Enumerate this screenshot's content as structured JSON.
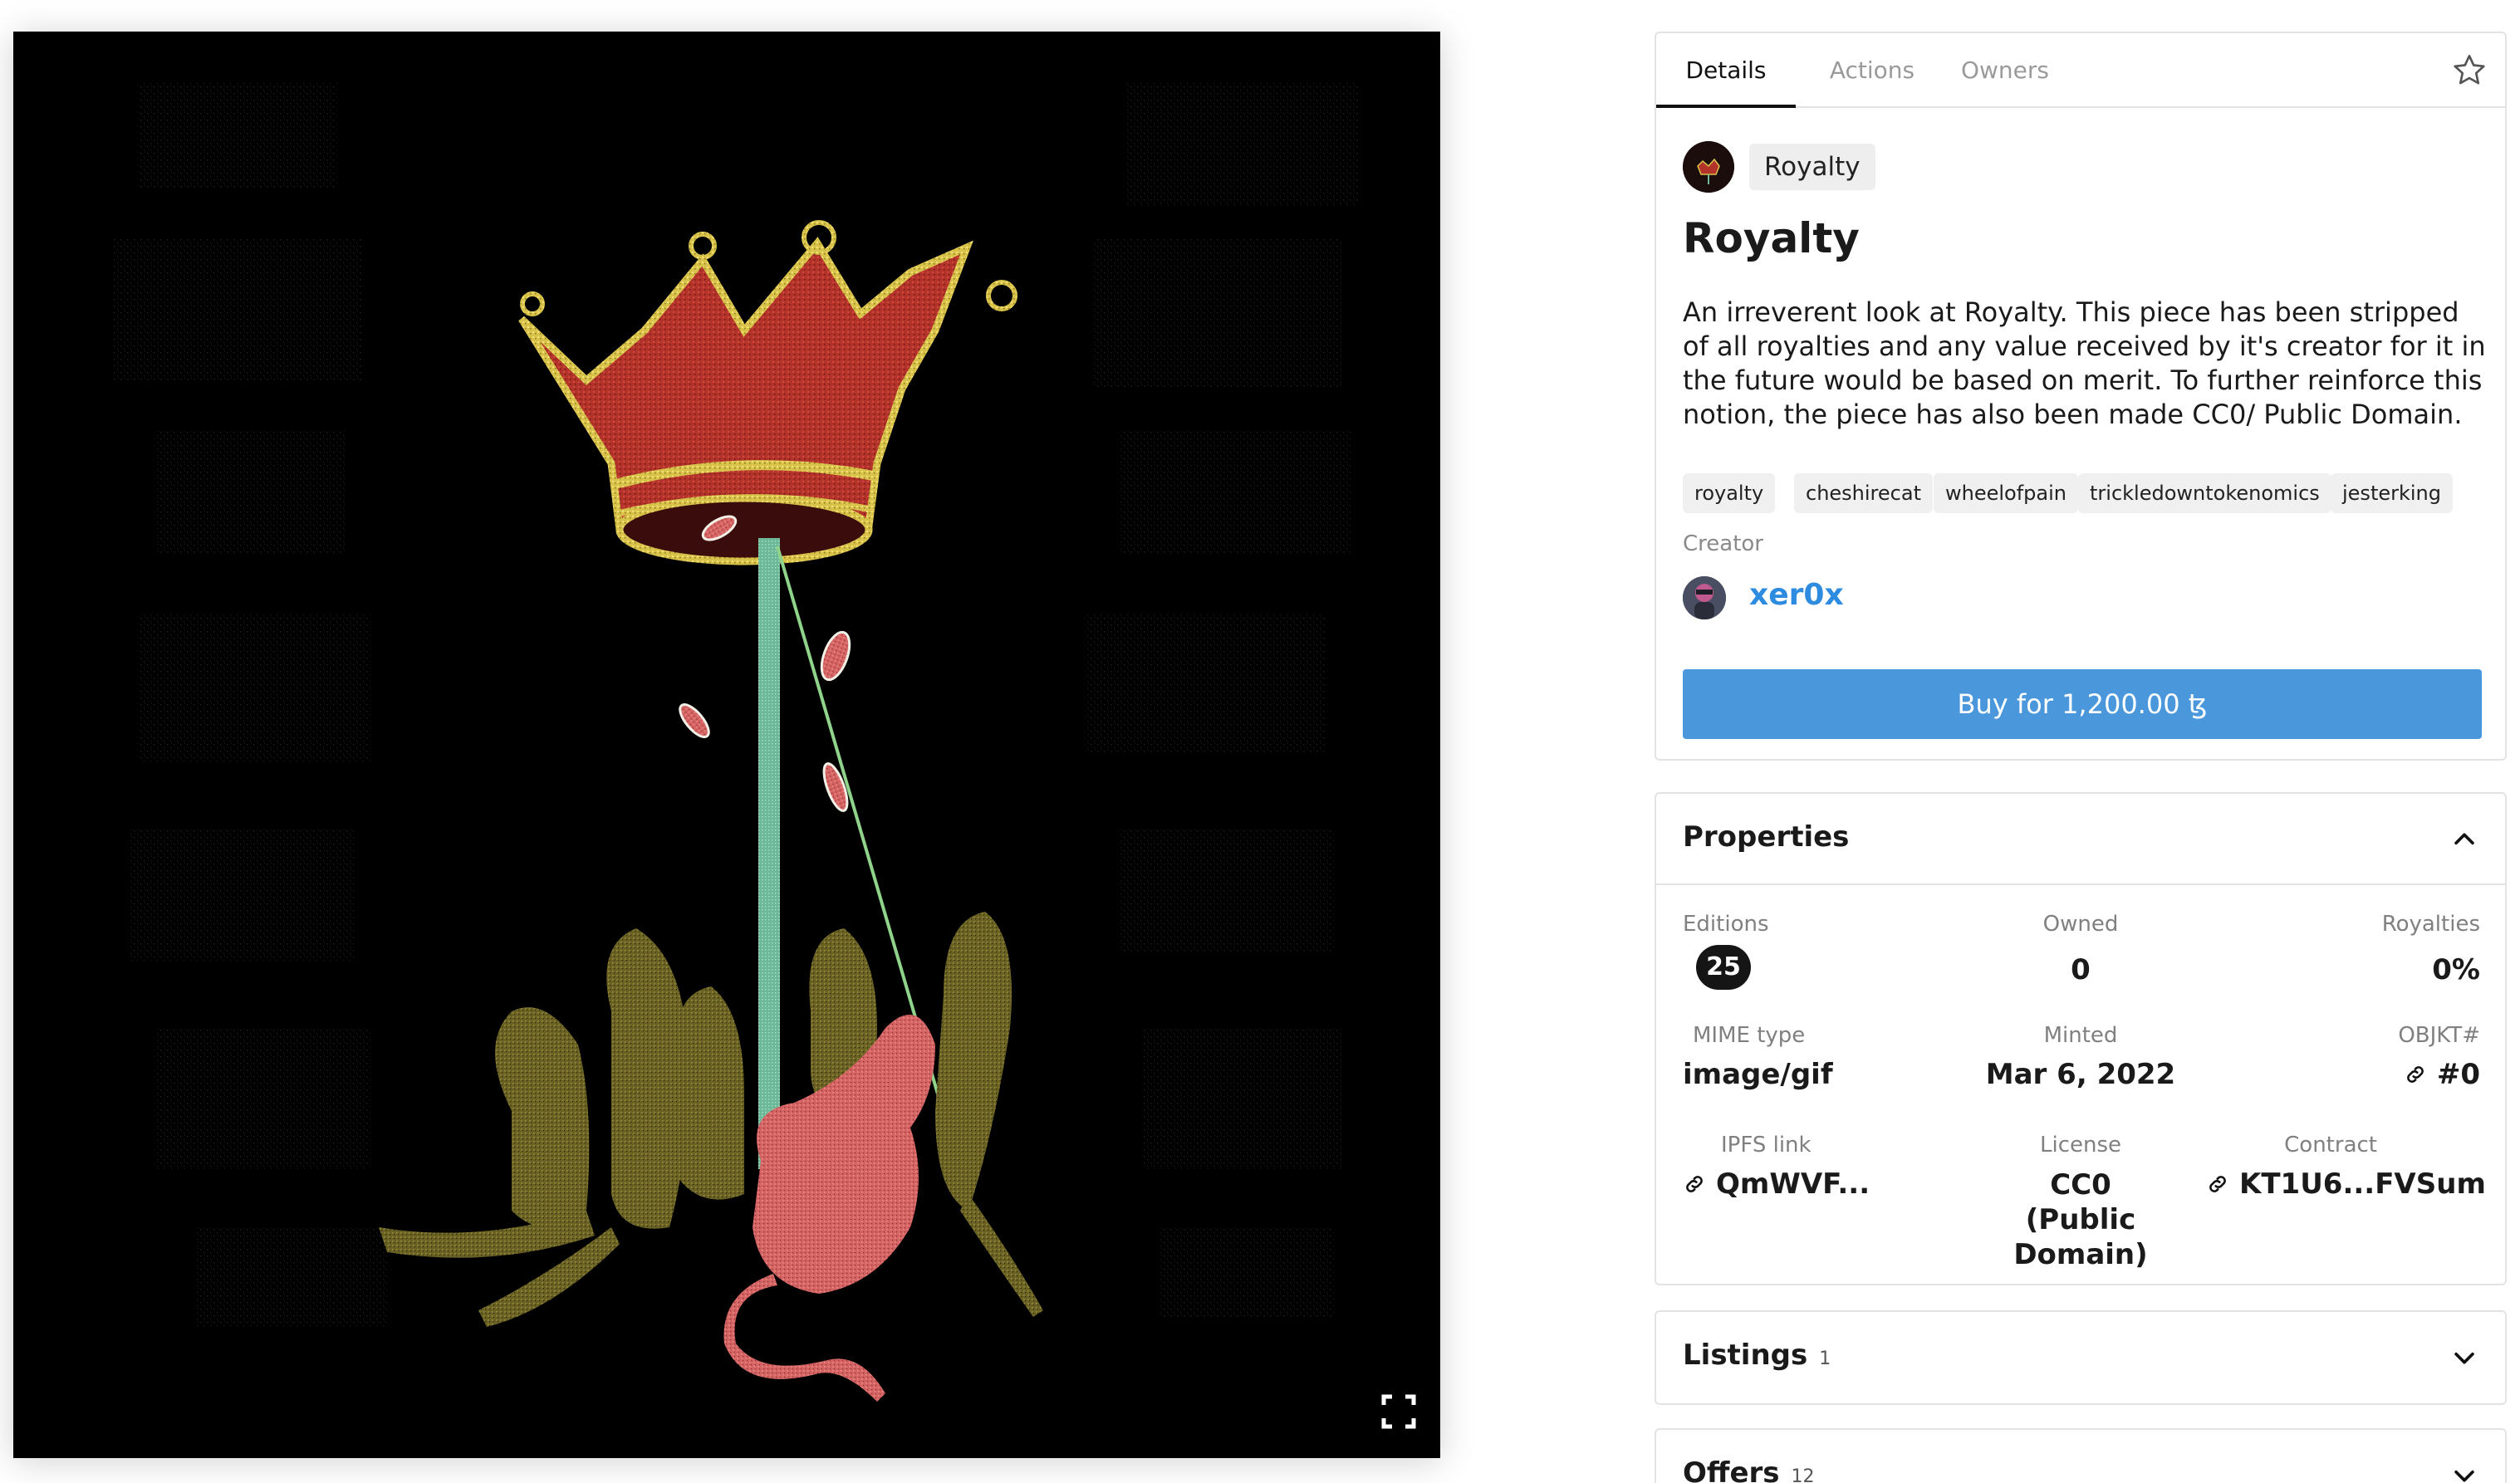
{
  "tabs": [
    {
      "label": "Details",
      "active": true
    },
    {
      "label": "Actions",
      "active": false
    },
    {
      "label": "Owners",
      "active": false
    }
  ],
  "collection": {
    "name": "Royalty"
  },
  "item": {
    "title": "Royalty",
    "description": "An irreverent look at Royalty. This piece has been stripped of all royalties and any value received by it's creator for it in the future would be based on merit. To further reinforce this notion, the piece has also been made CC0/ Public Domain."
  },
  "tags": [
    "royalty",
    "cheshirecat",
    "wheelofpain",
    "trickledowntokenomics",
    "jesterking"
  ],
  "creator": {
    "label": "Creator",
    "name": "xer0x"
  },
  "buy_button": {
    "label": "Buy for 1,200.00 ꜩ"
  },
  "properties": {
    "title": "Properties",
    "editions": {
      "label": "Editions",
      "value": "25"
    },
    "owned": {
      "label": "Owned",
      "value": "0"
    },
    "royalties": {
      "label": "Royalties",
      "value": "0%"
    },
    "mime": {
      "label": "MIME type",
      "value": "image/gif"
    },
    "minted": {
      "label": "Minted",
      "value": "Mar 6, 2022"
    },
    "objkt": {
      "label": "OBJKT#",
      "value": "#0"
    },
    "ipfs": {
      "label": "IPFS link",
      "value": "QmWVF..."
    },
    "license": {
      "label": "License",
      "value": "CC0 (Public Domain)"
    },
    "contract": {
      "label": "Contract",
      "value": "KT1U6...FVSum"
    }
  },
  "listings": {
    "title": "Listings",
    "count": "1"
  },
  "offers": {
    "title": "Offers",
    "count": "12"
  },
  "colors": {
    "accent": "#4a97dc",
    "creator_link": "#2d8be0",
    "artwork_bg": "#000000"
  }
}
